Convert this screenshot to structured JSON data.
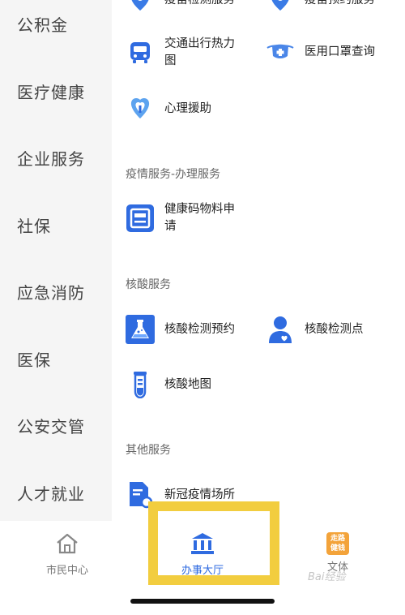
{
  "sidebar": {
    "items": [
      {
        "label": "公积金"
      },
      {
        "label": "医疗健康"
      },
      {
        "label": "企业服务"
      },
      {
        "label": "社保"
      },
      {
        "label": "应急消防"
      },
      {
        "label": "医保"
      },
      {
        "label": "公安交管"
      },
      {
        "label": "人才就业"
      }
    ]
  },
  "main": {
    "top_partial": [
      {
        "label": "疫苗检测服务",
        "icon": "location-pin-icon"
      },
      {
        "label": "疫苗预约服务",
        "icon": "location-pin-icon"
      }
    ],
    "tiles_top": [
      {
        "label": "交通出行热力图",
        "icon": "bus-icon"
      },
      {
        "label": "医用口罩查询",
        "icon": "face-mask-icon"
      },
      {
        "label": "心理援助",
        "icon": "heart-hands-icon"
      }
    ],
    "sections": [
      {
        "title": "疫情服务-办理服务",
        "tiles": [
          {
            "label": "健康码物料申请",
            "icon": "document-frame-icon"
          }
        ]
      },
      {
        "title": "核酸服务",
        "tiles": [
          {
            "label": "核酸检测预约",
            "icon": "flask-icon"
          },
          {
            "label": "核酸检测点",
            "icon": "doctor-icon"
          },
          {
            "label": "核酸地图",
            "icon": "test-tube-icon"
          }
        ]
      },
      {
        "title": "其他服务",
        "tiles": [
          {
            "label": "新冠疫情场所",
            "icon": "document-search-icon"
          }
        ]
      }
    ]
  },
  "tabbar": {
    "tabs": [
      {
        "label": "市民中心",
        "icon": "home-icon",
        "active": false
      },
      {
        "label": "办事大厅",
        "icon": "government-hall-icon",
        "active": true
      },
      {
        "label": "文体",
        "icon": "culture-badge-icon",
        "active": false
      }
    ],
    "culture_badge_text": "走路\n健钱"
  },
  "watermark": "Bai经验",
  "colors": {
    "accent": "#2f6be0",
    "sidebar_bg": "#f5f5f5",
    "highlight": "#f2cd3f",
    "section_title": "#666666"
  }
}
